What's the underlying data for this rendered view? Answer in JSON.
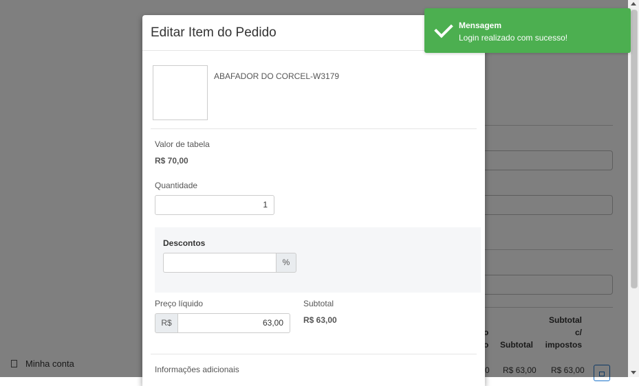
{
  "sidebar": {
    "account_label": "Minha conta"
  },
  "background_table": {
    "headers": {
      "partial_1": "o",
      "partial_2": "o",
      "subtotal": "Subtotal",
      "subtotal_tax_1": "Subtotal",
      "subtotal_tax_2": "c/",
      "subtotal_tax_3": "impostos"
    },
    "row": {
      "partial": "0",
      "subtotal": "R$ 63,00",
      "subtotal_tax": "R$ 63,00"
    }
  },
  "modal": {
    "title": "Editar Item do Pedido",
    "product_name": "ABAFADOR DO CORCEL-W3179",
    "table_price_label": "Valor de tabela",
    "table_price_value": "R$ 70,00",
    "quantity_label": "Quantidade",
    "quantity_value": "1",
    "discounts_title": "Descontos",
    "discount_value": "",
    "discount_unit": "%",
    "net_price_label": "Preço líquido",
    "currency_prefix": "R$",
    "net_price_value": "63,00",
    "subtotal_label": "Subtotal",
    "subtotal_value": "R$ 63,00",
    "additional_info_label": "Informações adicionais"
  },
  "toast": {
    "title": "Mensagem",
    "message": "Login realizado com sucesso!",
    "color": "#4caf50"
  }
}
